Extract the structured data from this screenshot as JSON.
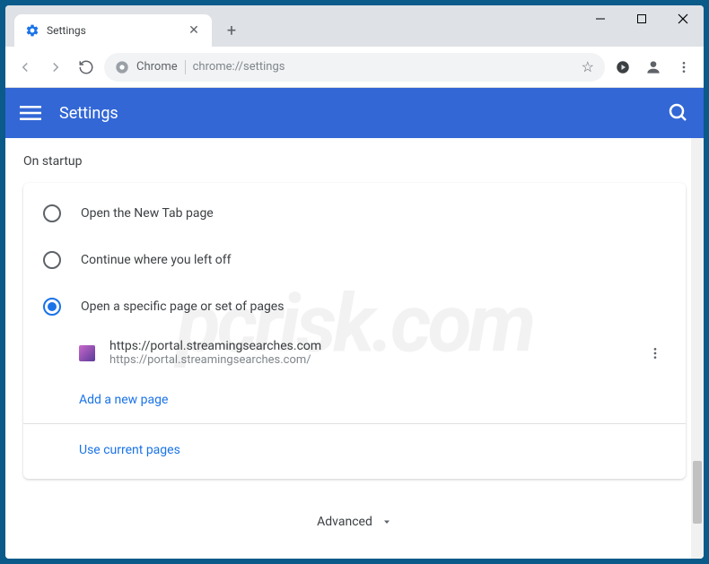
{
  "tab": {
    "title": "Settings"
  },
  "address": {
    "chip": "Chrome",
    "url": "chrome://settings"
  },
  "header": {
    "title": "Settings"
  },
  "section": {
    "title": "On startup"
  },
  "radios": {
    "opt1": "Open the New Tab page",
    "opt2": "Continue where you left off",
    "opt3": "Open a specific page or set of pages"
  },
  "startup_page": {
    "name": "https://portal.streamingsearches.com",
    "url": "https://portal.streamingsearches.com/"
  },
  "links": {
    "add": "Add a new page",
    "current": "Use current pages"
  },
  "advanced": "Advanced",
  "watermark": "pcrisk.com"
}
